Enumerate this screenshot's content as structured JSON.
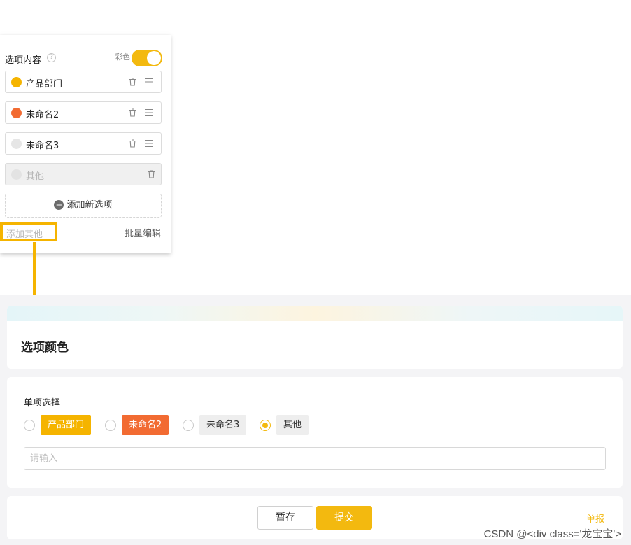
{
  "editor": {
    "title": "选项内容",
    "help_icon": "question-circle-icon",
    "color_toggle_label": "彩色",
    "color_toggle_on": true,
    "options": [
      {
        "label": "产品部门",
        "color": "#f5b400",
        "disabled": false
      },
      {
        "label": "未命名2",
        "color": "#f26b32",
        "disabled": false
      },
      {
        "label": "未命名3",
        "color": "#e6e6e6",
        "disabled": false
      },
      {
        "label": "其他",
        "color": "#e8e8e8",
        "disabled": true
      }
    ],
    "add_option_label": "添加新选项",
    "add_other_label": "添加其他",
    "batch_edit_label": "批量编辑"
  },
  "form": {
    "title": "选项颜色",
    "question_label": "单项选择",
    "choices": [
      {
        "label": "产品部门",
        "bg": "#f5b400",
        "fg": "#ffffff",
        "checked": false
      },
      {
        "label": "未命名2",
        "bg": "#f26b32",
        "fg": "#ffffff",
        "checked": false
      },
      {
        "label": "未命名3",
        "bg": "#eeeeee",
        "fg": "#333333",
        "checked": false
      },
      {
        "label": "其他",
        "bg": "#eeeeee",
        "fg": "#333333",
        "checked": true
      }
    ],
    "other_placeholder": "请输入",
    "save_label": "暂存",
    "submit_label": "提交",
    "report_label": "单报"
  },
  "watermark": "CSDN @<div class='龙宝宝'>",
  "colors": {
    "accent": "#f3b90f",
    "highlight": "#f5b400"
  }
}
